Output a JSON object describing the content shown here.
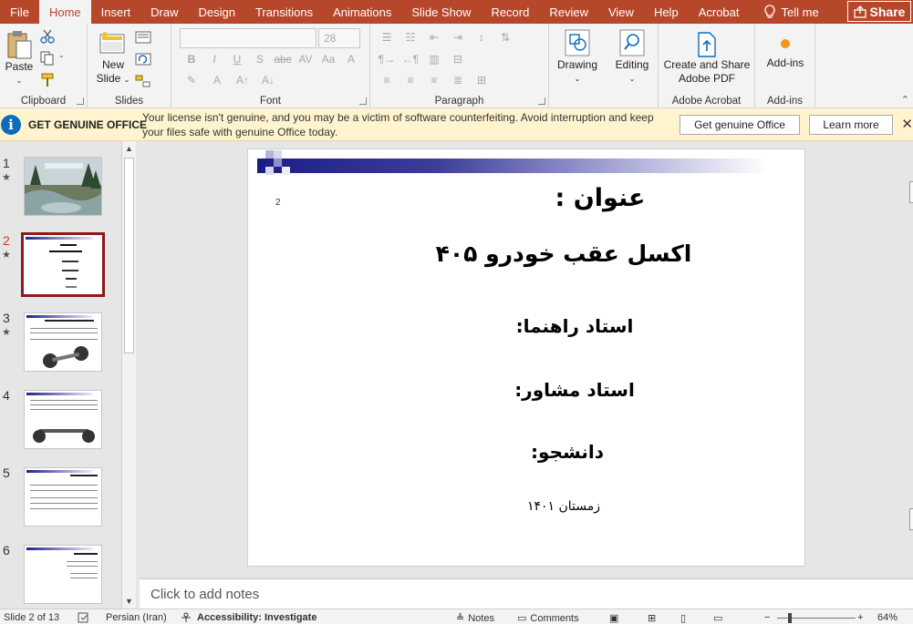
{
  "tabs": [
    "File",
    "Home",
    "Insert",
    "Draw",
    "Design",
    "Transitions",
    "Animations",
    "Slide Show",
    "Record",
    "Review",
    "View",
    "Help",
    "Acrobat"
  ],
  "active_tab": "Home",
  "tell_me": "Tell me",
  "share": "Share",
  "ribbon": {
    "clipboard": {
      "label": "Clipboard",
      "paste": "Paste"
    },
    "slides": {
      "label": "Slides",
      "new_slide_1": "New",
      "new_slide_2": "Slide"
    },
    "font": {
      "label": "Font",
      "font_size": "28"
    },
    "paragraph": {
      "label": "Paragraph"
    },
    "drawing": {
      "label": "Drawing"
    },
    "editing": {
      "label": "Editing"
    },
    "acrobat": {
      "label": "Adobe Acrobat",
      "button_1": "Create and Share",
      "button_2": "Adobe PDF"
    },
    "addins": {
      "label": "Add-ins",
      "button": "Add-ins"
    }
  },
  "notification": {
    "title": "GET GENUINE OFFICE",
    "message": "Your license isn't genuine, and you may be a victim of software counterfeiting. Avoid interruption and keep your files safe with genuine Office today.",
    "primary_button": "Get genuine Office",
    "secondary_button": "Learn more",
    "close": "✕"
  },
  "thumbnails": [
    {
      "num": "1",
      "star": "★",
      "selected": false
    },
    {
      "num": "2",
      "star": "★",
      "selected": true
    },
    {
      "num": "3",
      "star": "★",
      "selected": false
    },
    {
      "num": "4",
      "star": "",
      "selected": false
    },
    {
      "num": "5",
      "star": "",
      "selected": false
    },
    {
      "num": "6",
      "star": "",
      "selected": false
    }
  ],
  "slide": {
    "number": "2",
    "title": "عنوان :",
    "subtitle": "اکسل عقب خودرو ۴۰۵",
    "advisor": "استاد راهنما:",
    "consultant": "استاد مشاور:",
    "student": "دانشجو:",
    "date": "زمستان ۱۴۰۱"
  },
  "notes_placeholder": "Click to add notes",
  "status": {
    "slide_info": "Slide 2 of 13",
    "language": "Persian (Iran)",
    "accessibility": "Accessibility: Investigate",
    "notes": "Notes",
    "comments": "Comments",
    "zoom": "64%"
  }
}
